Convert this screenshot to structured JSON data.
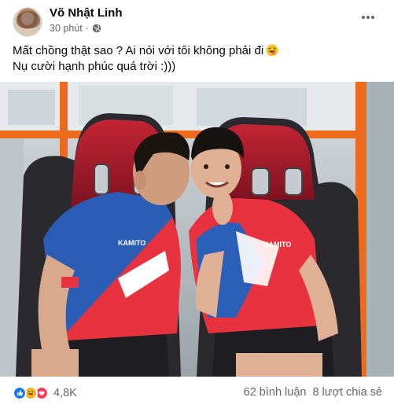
{
  "post": {
    "author": "Võ Nhật Linh",
    "time": "30 phút",
    "privacy_icon": "globe-icon",
    "more_icon": "more-options-icon",
    "caption_line1": "Mất chồng thật sao ? Ai nói với tôi không phải đi",
    "caption_line1_emoji": "laughing-tongue-emoji",
    "caption_line2": "Nụ cười hạnh phúc quá trời :)))",
    "image": {
      "jersey_text_left": "KAMITO",
      "jersey_text_right": "KAMITO"
    }
  },
  "footer": {
    "reaction_icons": [
      "like-icon",
      "haha-icon",
      "love-icon"
    ],
    "reaction_count": "4,8K",
    "comments": "62 bình luận",
    "shares": "8 lượt chia sẻ"
  },
  "colors": {
    "name": "#050505",
    "meta": "#65676b",
    "like": "#1877f2",
    "haha": "#f7b125",
    "love": "#f33e58",
    "jersey_red": "#e8323f",
    "jersey_blue": "#2c5fb8",
    "seat_red": "#b3212d",
    "frame_orange": "#ee6a1d"
  }
}
